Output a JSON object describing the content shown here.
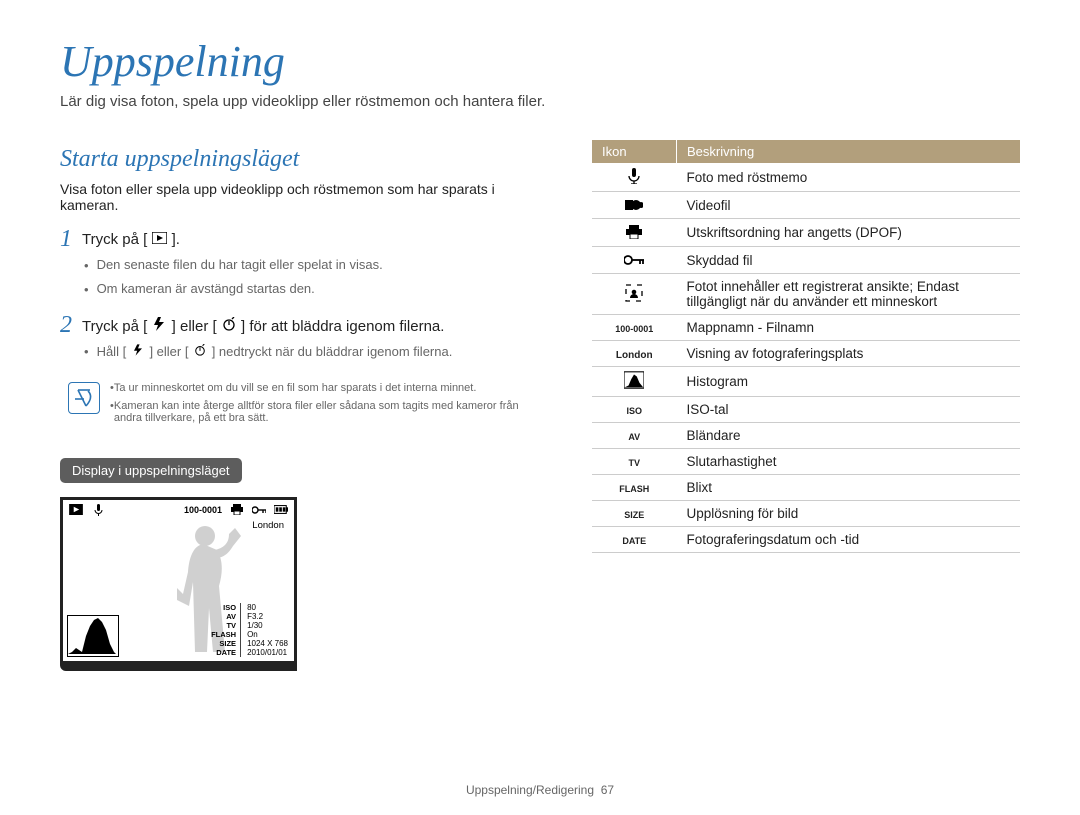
{
  "page": {
    "title": "Uppspelning",
    "intro": "Lär dig visa foton, spela upp videoklipp eller röstmemon och hantera filer."
  },
  "section": {
    "title": "Starta uppspelningsläget",
    "sub": "Visa foton eller spela upp videoklipp och röstmemon som har sparats i kameran."
  },
  "steps": {
    "s1": {
      "num": "1",
      "text_before": "Tryck på [",
      "text_after": "].",
      "bullets": [
        "Den senaste filen du har tagit eller spelat in visas.",
        "Om kameran är avstängd startas den."
      ]
    },
    "s2": {
      "num": "2",
      "text_parts": {
        "a": "Tryck på [",
        "b": "] eller [",
        "c": "] för att bläddra igenom filerna."
      },
      "bullet_before": "Håll [",
      "bullet_mid": "] eller [",
      "bullet_after": "] nedtryckt när du bläddrar igenom filerna."
    }
  },
  "note": {
    "items": [
      "Ta ur minneskortet om du vill se en fil som har sparats i det interna minnet.",
      "Kameran kan inte återge alltför stora filer eller sådana som tagits med kameror från andra tillverkare, på ett bra sätt."
    ]
  },
  "pill": "Display i uppspelningsläget",
  "lcd": {
    "filename": "100-0001",
    "city": "London",
    "specs": {
      "iso_k": "ISO",
      "iso_v": "80",
      "av_k": "AV",
      "av_v": "F3.2",
      "tv_k": "TV",
      "tv_v": "1/30",
      "flash_k": "FLASH",
      "flash_v": "On",
      "size_k": "SIZE",
      "size_v": "1024 X 768",
      "date_k": "DATE",
      "date_v": "2010/01/01"
    }
  },
  "table": {
    "h0": "Ikon",
    "h1": "Beskrivning",
    "rows": {
      "r0": {
        "label": "mic",
        "desc": "Foto med röstmemo"
      },
      "r1": {
        "label": "video",
        "desc": "Videofil"
      },
      "r2": {
        "label": "printer",
        "desc": "Utskriftsordning har angetts (DPOF)"
      },
      "r3": {
        "label": "key",
        "desc": "Skyddad fil"
      },
      "r4": {
        "label": "face",
        "desc": "Fotot innehåller ett registrerat ansikte; Endast tillgängligt när du använder ett minneskort"
      },
      "r5": {
        "label": "100-0001",
        "desc": "Mappnamn - Filnamn"
      },
      "r6": {
        "label": "London",
        "desc": "Visning av fotograferingsplats"
      },
      "r7": {
        "label": "histogram",
        "desc": "Histogram"
      },
      "r8": {
        "label": "ISO",
        "desc": "ISO-tal"
      },
      "r9": {
        "label": "AV",
        "desc": "Bländare"
      },
      "r10": {
        "label": "TV",
        "desc": "Slutarhastighet"
      },
      "r11": {
        "label": "FLASH",
        "desc": "Blixt"
      },
      "r12": {
        "label": "SIZE",
        "desc": "Upplösning för bild"
      },
      "r13": {
        "label": "DATE",
        "desc": "Fotograferingsdatum och -tid"
      }
    }
  },
  "footer": {
    "text": "Uppspelning/Redigering",
    "num": "67"
  }
}
